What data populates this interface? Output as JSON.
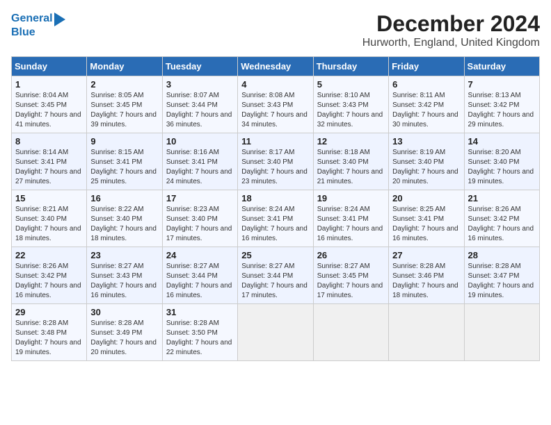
{
  "header": {
    "logo": {
      "line1": "General",
      "line2": "Blue"
    },
    "title": "December 2024",
    "subtitle": "Hurworth, England, United Kingdom"
  },
  "calendar": {
    "days_of_week": [
      "Sunday",
      "Monday",
      "Tuesday",
      "Wednesday",
      "Thursday",
      "Friday",
      "Saturday"
    ],
    "weeks": [
      [
        {
          "day": null,
          "detail": ""
        },
        {
          "day": 2,
          "detail": "Sunrise: 8:05 AM\nSunset: 3:45 PM\nDaylight: 7 hours and 39 minutes."
        },
        {
          "day": 3,
          "detail": "Sunrise: 8:07 AM\nSunset: 3:44 PM\nDaylight: 7 hours and 36 minutes."
        },
        {
          "day": 4,
          "detail": "Sunrise: 8:08 AM\nSunset: 3:43 PM\nDaylight: 7 hours and 34 minutes."
        },
        {
          "day": 5,
          "detail": "Sunrise: 8:10 AM\nSunset: 3:43 PM\nDaylight: 7 hours and 32 minutes."
        },
        {
          "day": 6,
          "detail": "Sunrise: 8:11 AM\nSunset: 3:42 PM\nDaylight: 7 hours and 30 minutes."
        },
        {
          "day": 7,
          "detail": "Sunrise: 8:13 AM\nSunset: 3:42 PM\nDaylight: 7 hours and 29 minutes."
        }
      ],
      [
        {
          "day": 1,
          "detail": "Sunrise: 8:04 AM\nSunset: 3:45 PM\nDaylight: 7 hours and 41 minutes."
        },
        {
          "day": null,
          "detail": ""
        },
        {
          "day": null,
          "detail": ""
        },
        {
          "day": null,
          "detail": ""
        },
        {
          "day": null,
          "detail": ""
        },
        {
          "day": null,
          "detail": ""
        },
        {
          "day": null,
          "detail": ""
        }
      ],
      [
        {
          "day": 8,
          "detail": "Sunrise: 8:14 AM\nSunset: 3:41 PM\nDaylight: 7 hours and 27 minutes."
        },
        {
          "day": 9,
          "detail": "Sunrise: 8:15 AM\nSunset: 3:41 PM\nDaylight: 7 hours and 25 minutes."
        },
        {
          "day": 10,
          "detail": "Sunrise: 8:16 AM\nSunset: 3:41 PM\nDaylight: 7 hours and 24 minutes."
        },
        {
          "day": 11,
          "detail": "Sunrise: 8:17 AM\nSunset: 3:40 PM\nDaylight: 7 hours and 23 minutes."
        },
        {
          "day": 12,
          "detail": "Sunrise: 8:18 AM\nSunset: 3:40 PM\nDaylight: 7 hours and 21 minutes."
        },
        {
          "day": 13,
          "detail": "Sunrise: 8:19 AM\nSunset: 3:40 PM\nDaylight: 7 hours and 20 minutes."
        },
        {
          "day": 14,
          "detail": "Sunrise: 8:20 AM\nSunset: 3:40 PM\nDaylight: 7 hours and 19 minutes."
        }
      ],
      [
        {
          "day": 15,
          "detail": "Sunrise: 8:21 AM\nSunset: 3:40 PM\nDaylight: 7 hours and 18 minutes."
        },
        {
          "day": 16,
          "detail": "Sunrise: 8:22 AM\nSunset: 3:40 PM\nDaylight: 7 hours and 18 minutes."
        },
        {
          "day": 17,
          "detail": "Sunrise: 8:23 AM\nSunset: 3:40 PM\nDaylight: 7 hours and 17 minutes."
        },
        {
          "day": 18,
          "detail": "Sunrise: 8:24 AM\nSunset: 3:41 PM\nDaylight: 7 hours and 16 minutes."
        },
        {
          "day": 19,
          "detail": "Sunrise: 8:24 AM\nSunset: 3:41 PM\nDaylight: 7 hours and 16 minutes."
        },
        {
          "day": 20,
          "detail": "Sunrise: 8:25 AM\nSunset: 3:41 PM\nDaylight: 7 hours and 16 minutes."
        },
        {
          "day": 21,
          "detail": "Sunrise: 8:26 AM\nSunset: 3:42 PM\nDaylight: 7 hours and 16 minutes."
        }
      ],
      [
        {
          "day": 22,
          "detail": "Sunrise: 8:26 AM\nSunset: 3:42 PM\nDaylight: 7 hours and 16 minutes."
        },
        {
          "day": 23,
          "detail": "Sunrise: 8:27 AM\nSunset: 3:43 PM\nDaylight: 7 hours and 16 minutes."
        },
        {
          "day": 24,
          "detail": "Sunrise: 8:27 AM\nSunset: 3:44 PM\nDaylight: 7 hours and 16 minutes."
        },
        {
          "day": 25,
          "detail": "Sunrise: 8:27 AM\nSunset: 3:44 PM\nDaylight: 7 hours and 17 minutes."
        },
        {
          "day": 26,
          "detail": "Sunrise: 8:27 AM\nSunset: 3:45 PM\nDaylight: 7 hours and 17 minutes."
        },
        {
          "day": 27,
          "detail": "Sunrise: 8:28 AM\nSunset: 3:46 PM\nDaylight: 7 hours and 18 minutes."
        },
        {
          "day": 28,
          "detail": "Sunrise: 8:28 AM\nSunset: 3:47 PM\nDaylight: 7 hours and 19 minutes."
        }
      ],
      [
        {
          "day": 29,
          "detail": "Sunrise: 8:28 AM\nSunset: 3:48 PM\nDaylight: 7 hours and 19 minutes."
        },
        {
          "day": 30,
          "detail": "Sunrise: 8:28 AM\nSunset: 3:49 PM\nDaylight: 7 hours and 20 minutes."
        },
        {
          "day": 31,
          "detail": "Sunrise: 8:28 AM\nSunset: 3:50 PM\nDaylight: 7 hours and 22 minutes."
        },
        {
          "day": null,
          "detail": ""
        },
        {
          "day": null,
          "detail": ""
        },
        {
          "day": null,
          "detail": ""
        },
        {
          "day": null,
          "detail": ""
        }
      ]
    ]
  }
}
